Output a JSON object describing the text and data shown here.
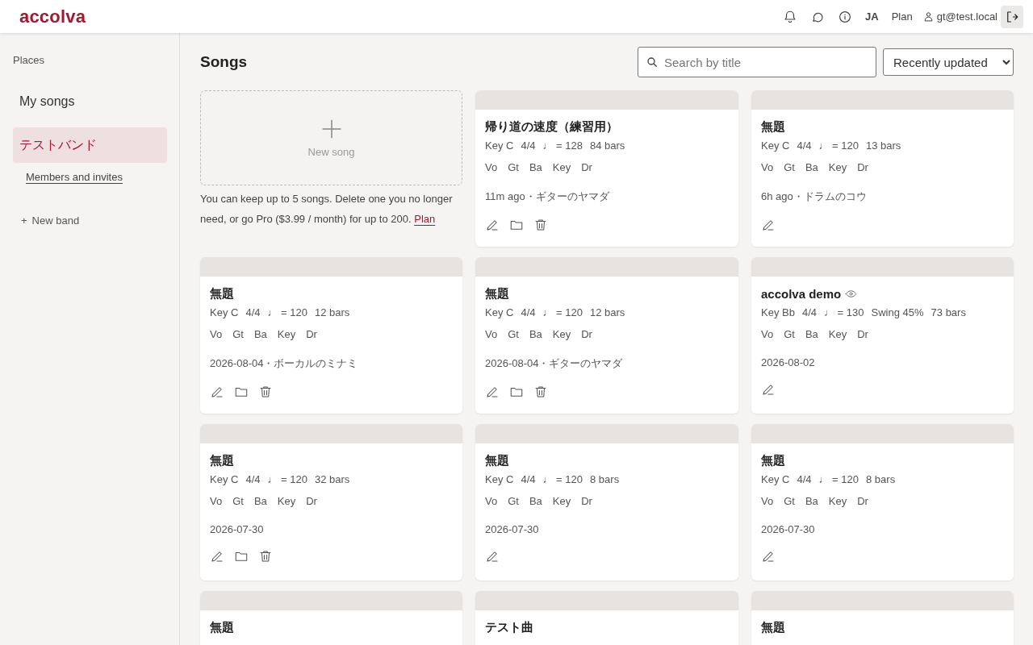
{
  "header": {
    "logo": "accolva",
    "language": "JA",
    "plan": "Plan",
    "user": "gt@test.local"
  },
  "sidebar": {
    "heading": "Places",
    "items": [
      {
        "label": "My songs",
        "selected": false
      },
      {
        "label": "テストバンド",
        "selected": true
      }
    ],
    "sublink": "Members and invites",
    "new_band": {
      "icon": "+",
      "label": "New band"
    }
  },
  "main": {
    "title": "Songs",
    "search": {
      "placeholder": "Search by title"
    },
    "sort": "Recently updated",
    "new_song": {
      "label": "New song"
    },
    "limit_note": "You can keep up to 5 songs. Delete one you no longer need, or go Pro ($3.99 / month) for up to 200.",
    "limit_link": "Plan",
    "songs": [
      {
        "title": "帰り道の速度（練習用）",
        "watched": false,
        "meta": [
          "Key C",
          "4/4",
          "♩ = 128",
          "84 bars"
        ],
        "parts": [
          "Vo",
          "Gt",
          "Ba",
          "Key",
          "Dr"
        ],
        "updated": "11m ago・ギターのヤマダ",
        "can_manage": true
      },
      {
        "title": "無題",
        "watched": false,
        "meta": [
          "Key C",
          "4/4",
          "♩ = 120",
          "13 bars"
        ],
        "parts": [
          "Vo",
          "Gt",
          "Ba",
          "Key",
          "Dr"
        ],
        "updated": "6h ago・ドラムのコウ",
        "can_manage": false
      },
      {
        "title": "無題",
        "watched": false,
        "meta": [
          "Key C",
          "4/4",
          "♩ = 120",
          "12 bars"
        ],
        "parts": [
          "Vo",
          "Gt",
          "Ba",
          "Key",
          "Dr"
        ],
        "updated": "2026-08-04・ボーカルのミナミ",
        "can_manage": true
      },
      {
        "title": "無題",
        "watched": false,
        "meta": [
          "Key C",
          "4/4",
          "♩ = 120",
          "12 bars"
        ],
        "parts": [
          "Vo",
          "Gt",
          "Ba",
          "Key",
          "Dr"
        ],
        "updated": "2026-08-04・ギターのヤマダ",
        "can_manage": true
      },
      {
        "title": "accolva demo",
        "watched": true,
        "meta": [
          "Key Bb",
          "4/4",
          "♩ = 130",
          "Swing 45%",
          "73 bars"
        ],
        "parts": [
          "Vo",
          "Gt",
          "Ba",
          "Key",
          "Dr"
        ],
        "updated": "2026-08-02",
        "can_manage": false
      },
      {
        "title": "無題",
        "watched": false,
        "meta": [
          "Key C",
          "4/4",
          "♩ = 120",
          "32 bars"
        ],
        "parts": [
          "Vo",
          "Gt",
          "Ba",
          "Key",
          "Dr"
        ],
        "updated": "2026-07-30",
        "can_manage": true
      },
      {
        "title": "無題",
        "watched": false,
        "meta": [
          "Key C",
          "4/4",
          "♩ = 120",
          "8 bars"
        ],
        "parts": [
          "Vo",
          "Gt",
          "Ba",
          "Key",
          "Dr"
        ],
        "updated": "2026-07-30",
        "can_manage": false
      },
      {
        "title": "無題",
        "watched": false,
        "meta": [
          "Key C",
          "4/4",
          "♩ = 120",
          "8 bars"
        ],
        "parts": [
          "Vo",
          "Gt",
          "Ba",
          "Key",
          "Dr"
        ],
        "updated": "2026-07-30",
        "can_manage": false
      },
      {
        "title": "無題"
      },
      {
        "title": "テスト曲"
      },
      {
        "title": "無題"
      }
    ]
  }
}
